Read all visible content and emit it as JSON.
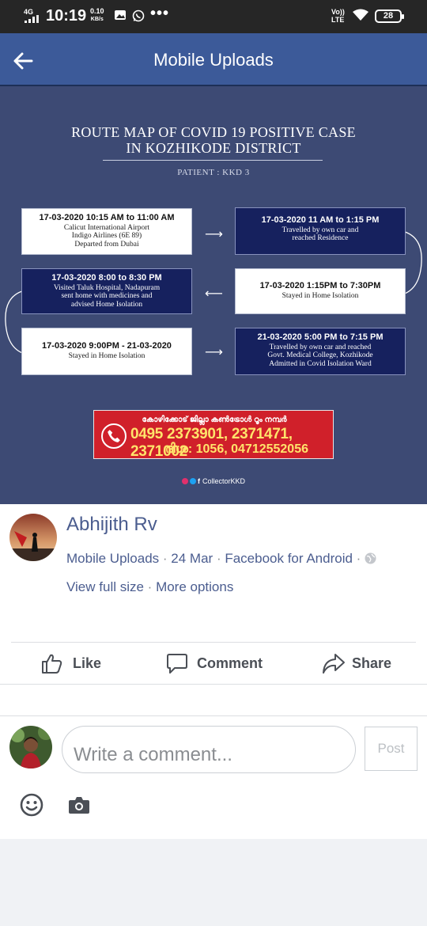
{
  "status_bar": {
    "network": "4G",
    "time": "10:19",
    "speed_value": "0.10",
    "speed_unit": "KB/s",
    "overflow": "•••",
    "volte_top": "Vo))",
    "volte_bottom": "LTE",
    "battery": "28"
  },
  "header": {
    "title": "Mobile Uploads"
  },
  "photo": {
    "title_line1": "ROUTE MAP OF COVID 19 POSITIVE CASE",
    "title_line2": "IN KOZHIKODE DISTRICT",
    "patient": "PATIENT : KKD 3",
    "steps": [
      {
        "datetime": "17-03-2020 10:15 AM to 11:00 AM",
        "lines": [
          "Calicut International Airport",
          "Indigo Airlines (6E 89)",
          "Departed from Dubai"
        ]
      },
      {
        "datetime": "17-03-2020 11 AM to 1:15 PM",
        "lines": [
          "Travelled by own car and",
          "reached Residence"
        ]
      },
      {
        "datetime": "17-03-2020 1:15PM to 7:30PM",
        "lines": [
          "Stayed in Home Isolation"
        ]
      },
      {
        "datetime": "17-03-2020 8:00 to 8:30 PM",
        "lines": [
          "Visited Taluk Hospital, Nadapuram",
          "sent home with medicines and",
          "advised Home Isolation"
        ]
      },
      {
        "datetime": "17-03-2020 9:00PM - 21-03-2020",
        "lines": [
          "Stayed in Home Isolation"
        ]
      },
      {
        "datetime": "21-03-2020 5:00 PM to 7:15 PM",
        "lines": [
          "Travelled by own car and reached",
          "Govt. Medical College, Kozhikode",
          "Admitted in Covid Isolation Ward"
        ]
      }
    ],
    "helpline_ml": "കോഴിക്കോട് ജില്ലാ കൺട്രോൾ റൂം നമ്പർ",
    "helpline_numbers": "0495 2373901, 2371471, 2371002",
    "helpline_disha": "ദിശ: 1056, 04712552056",
    "credit": "CollectorKKD"
  },
  "post": {
    "author": "Abhijith Rv",
    "album": "Mobile Uploads",
    "date": "24 Mar",
    "app": "Facebook for Android",
    "view_full_size": "View full size",
    "more_options": "More options",
    "actions": {
      "like": "Like",
      "comment": "Comment",
      "share": "Share"
    },
    "comment_placeholder": "Write a comment...",
    "post_button": "Post"
  },
  "colors": {
    "header_bg": "#3c5a99",
    "link_text": "#4b5d8f",
    "photo_bg": "#3d4a74",
    "box_navy": "#16215e",
    "banner_red": "#d0202a"
  }
}
